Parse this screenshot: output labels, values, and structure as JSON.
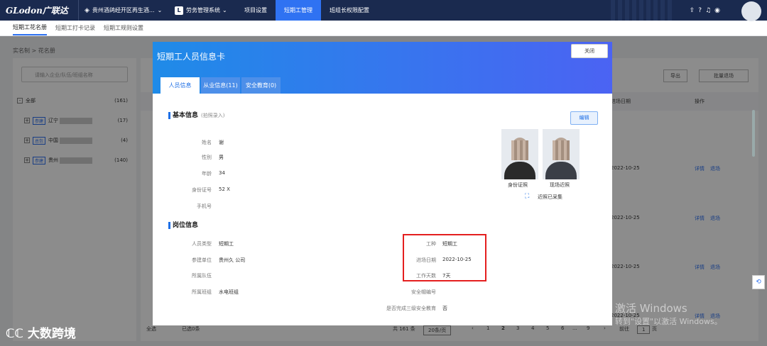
{
  "topbar": {
    "logo": "GLodon广联达",
    "project": "贵州酒鸽经开区再生酒...",
    "system": "劳务管理系统",
    "nav": [
      "项目设置",
      "短期工管理",
      "班组长权限配置"
    ],
    "active_nav": 1
  },
  "subtabs": [
    "短期工花名册",
    "短期工打卡记录",
    "短期工规则设置"
  ],
  "breadcrumb": "实名制  >  花名册",
  "left": {
    "search_placeholder": "请输入企业/队伍/班组名称",
    "items": [
      {
        "toggle": "-",
        "tag": "",
        "name": "全部",
        "count": "(161)"
      },
      {
        "toggle": "+",
        "tag": "参建",
        "name": "辽宁",
        "count": "(17)"
      },
      {
        "toggle": "+",
        "tag": "总包",
        "name": "中国",
        "count": "(4)"
      },
      {
        "toggle": "+",
        "tag": "参建",
        "name": "贵州",
        "count": "(140)"
      }
    ]
  },
  "right": {
    "export": "导出",
    "batch_exit": "批量退场",
    "col_date": "进场日期",
    "col_ops": "操作",
    "dates": [
      "2022-10-25",
      "2022-10-25",
      "2022-10-25",
      "2022-10-25"
    ],
    "op1": "详情",
    "op2": "退场",
    "footer": {
      "select_all": "全选",
      "selected": "已选0条",
      "total": "共 161 条",
      "page_size": "20条/页",
      "pages": [
        "1",
        "2",
        "3",
        "4",
        "5",
        "6",
        "...",
        "9"
      ],
      "goto": "前往",
      "page": "1",
      "page_unit": "页"
    }
  },
  "modal": {
    "title": "短期工人员信息卡",
    "close": "关闭",
    "tabs": [
      "人员信息",
      "从业信息(11)",
      "安全教育(0)"
    ],
    "basic_title": "基本信息",
    "basic_hint": "(拍照录入)",
    "edit": "编辑",
    "basic_fields": [
      {
        "label": "姓名",
        "value": "谢"
      },
      {
        "label": "性别",
        "value": "男"
      },
      {
        "label": "年龄",
        "value": "34"
      },
      {
        "label": "身份证号",
        "value": "52                         X"
      },
      {
        "label": "手机号",
        "value": ""
      }
    ],
    "photo_id": "身份证照",
    "photo_site": "现场近照",
    "face_status": "近照已采集",
    "post_title": "岗位信息",
    "post_left": [
      {
        "label": "人员类型",
        "value": "短期工"
      },
      {
        "label": "参建单位",
        "value": "贵州久                  公司"
      },
      {
        "label": "所属队伍",
        "value": ""
      },
      {
        "label": "所属班组",
        "value": "水电班组"
      }
    ],
    "post_right": [
      {
        "label": "工种",
        "value": "短期工"
      },
      {
        "label": "进场日期",
        "value": "2022-10-25"
      },
      {
        "label": "工作天数",
        "value": "7天"
      },
      {
        "label": "安全帽编号",
        "value": ""
      },
      {
        "label": "是否完成三级安全教育",
        "value": "否"
      }
    ]
  },
  "watermark": {
    "line1": "激活 Windows",
    "line2": "转到\"设置\"以激活 Windows。"
  },
  "brand": "大数跨境"
}
